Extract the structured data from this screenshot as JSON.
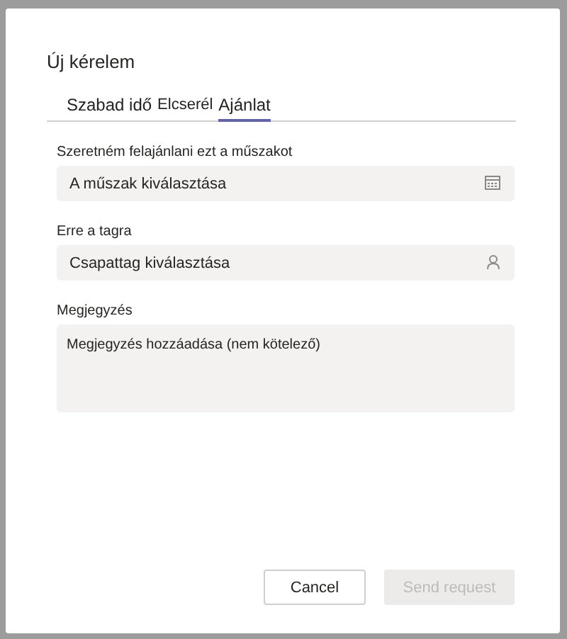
{
  "dialog": {
    "title": "Új kérelem"
  },
  "tabs": [
    {
      "label": "Szabad idő",
      "selected": false
    },
    {
      "label": "Elcserél",
      "selected": false
    },
    {
      "label": "Ajánlat",
      "selected": true
    }
  ],
  "fields": [
    {
      "kind": "shift-picker",
      "label": "Szeretném felajánlani ezt a műszakot",
      "placeholder": "A műszak kiválasztása"
    },
    {
      "kind": "member-picker",
      "label": "Erre a tagra",
      "placeholder": "Csapattag kiválasztása"
    },
    {
      "kind": "note",
      "label": "Megjegyzés",
      "placeholder": "Megjegyzés hozzáadása (nem kötelező)"
    }
  ],
  "buttons": [
    {
      "label": "Cancel",
      "disabled": false
    },
    {
      "label": "Send request",
      "disabled": true
    }
  ]
}
